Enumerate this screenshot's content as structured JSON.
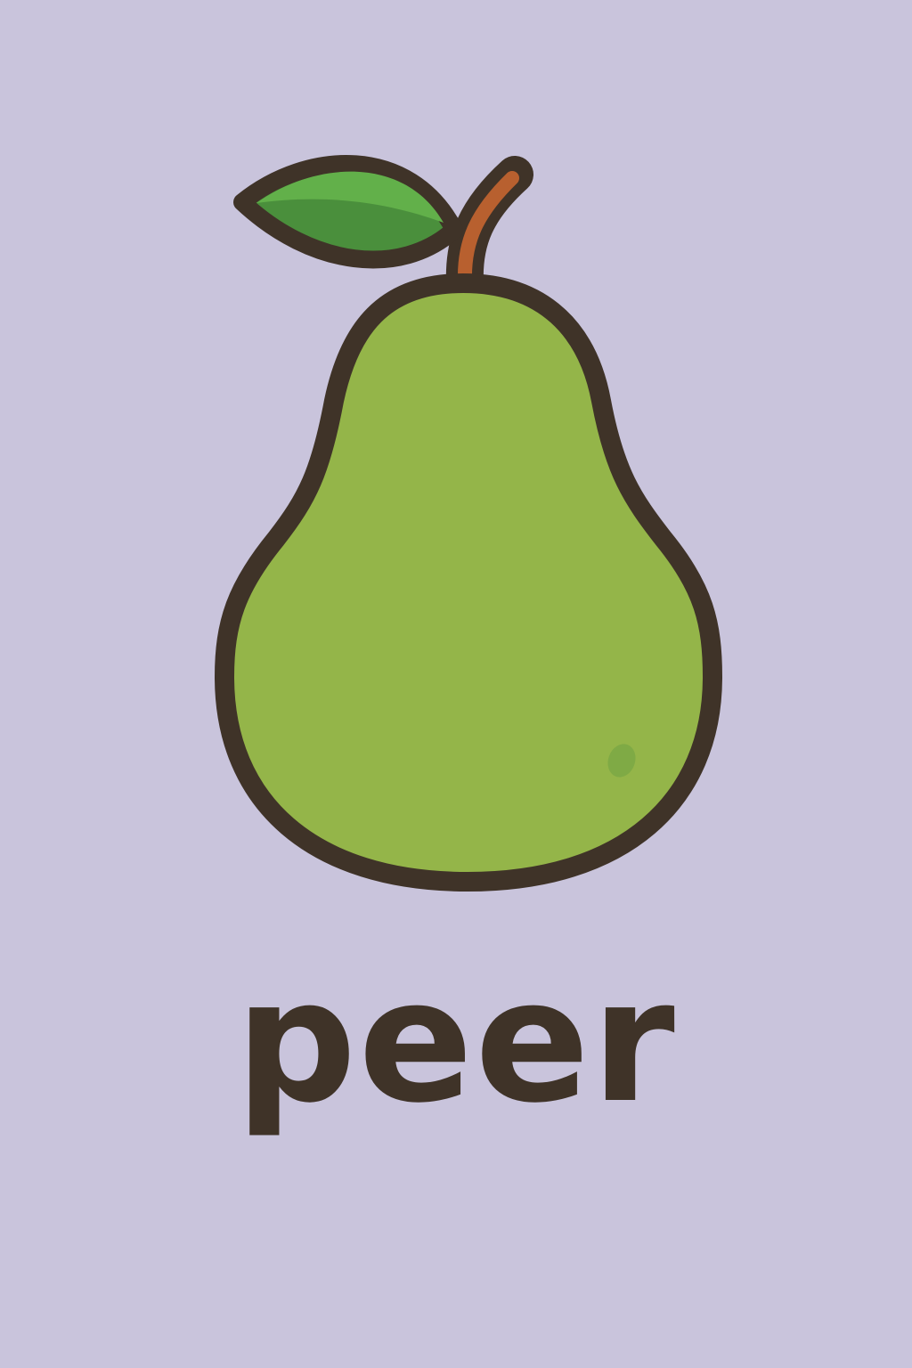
{
  "card": {
    "word": "peer",
    "icon": "pear-icon"
  },
  "colors": {
    "background": "#c9c4dc",
    "outline": "#3f3328",
    "pear_body": "#94b549",
    "leaf": "#4a9a3f",
    "leaf_highlight": "#62b04a",
    "stem": "#b8602f",
    "text": "#3f3328"
  }
}
